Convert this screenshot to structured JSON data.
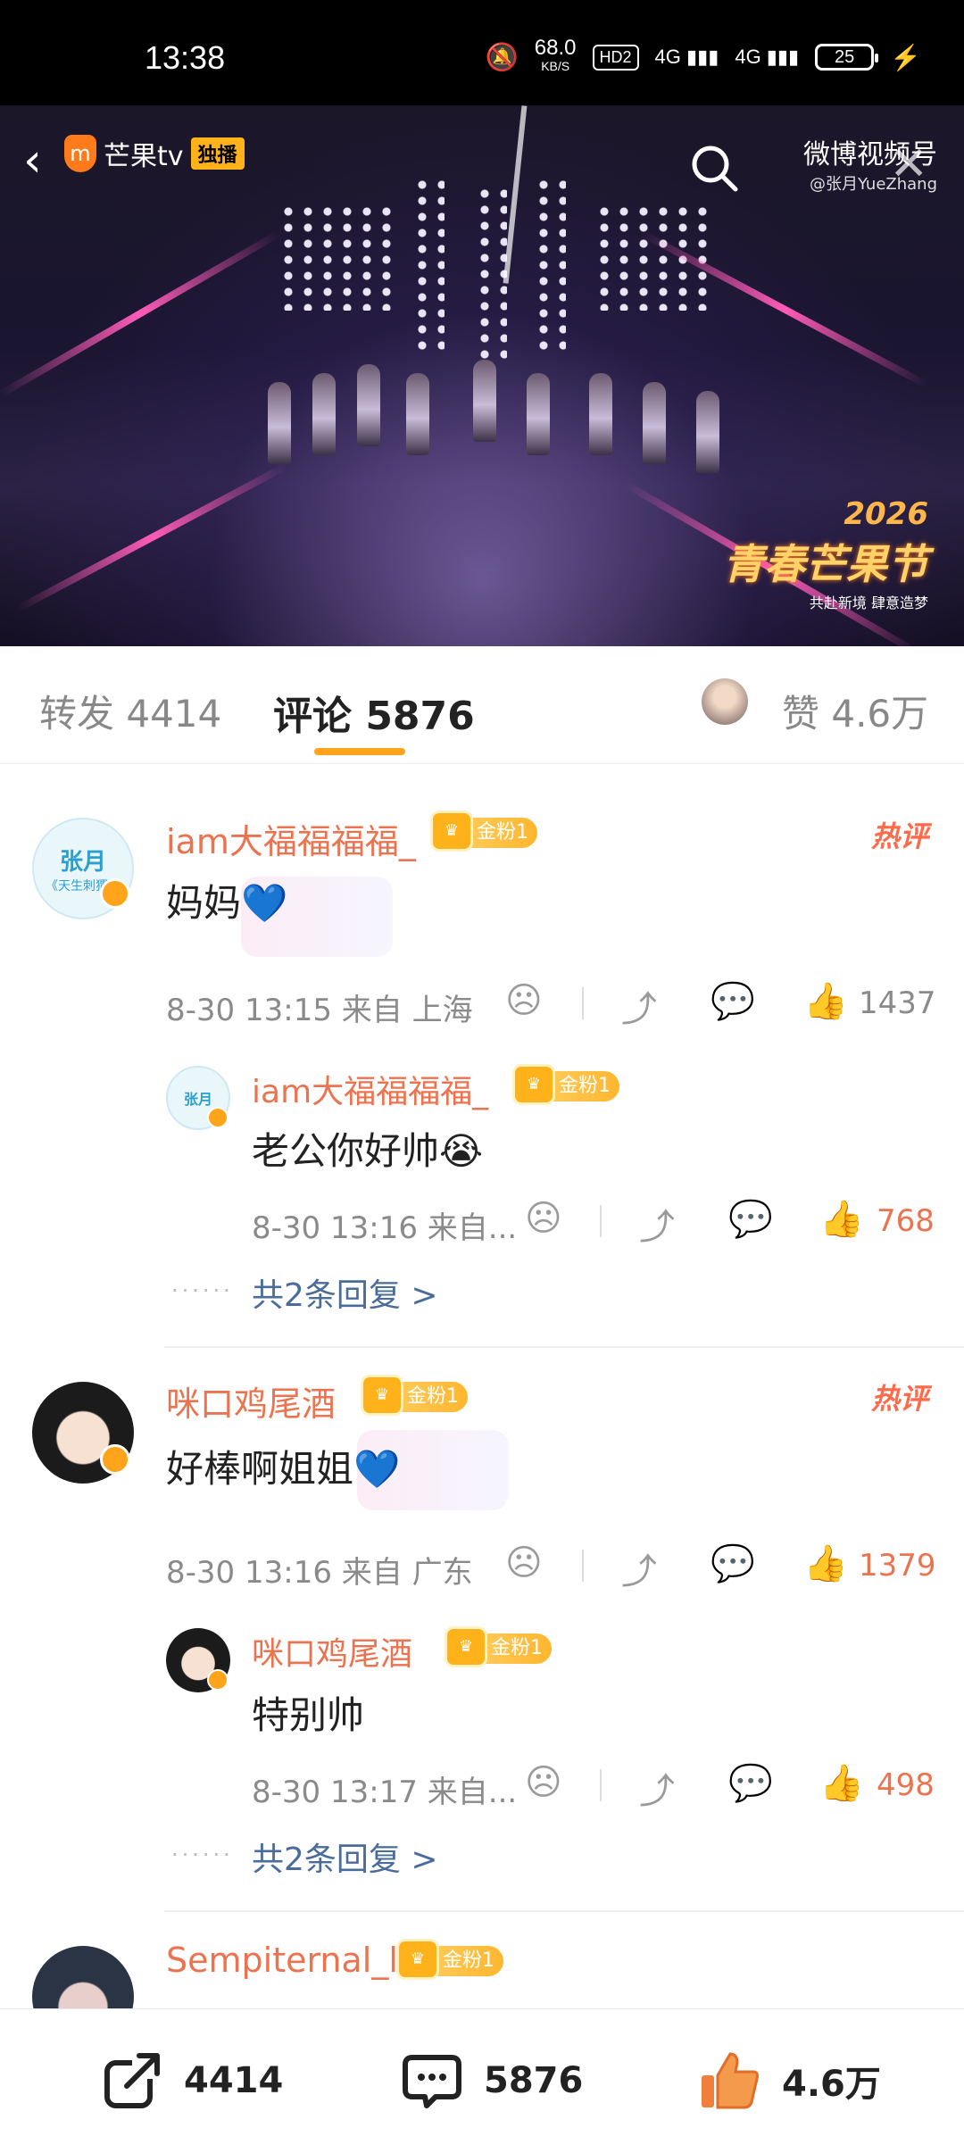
{
  "status_bar": {
    "time": "13:38",
    "net_speed_value": "68.0",
    "net_speed_unit": "KB/S",
    "hd_label": "HD2",
    "sim1": "4G",
    "sim2": "4G",
    "battery": "25"
  },
  "video": {
    "platform_logo": "芒果tv",
    "exclusive_label": "独播",
    "channel_name": "微博视频号",
    "channel_handle": "@张月YueZhang",
    "show_year": "2026",
    "show_name": "青春芒果节",
    "show_tagline": "共赴新境 肆意造梦"
  },
  "tabs": {
    "repost_label": "转发 4414",
    "comment_label": "评论 5876",
    "like_label": "赞 4.6万"
  },
  "comments": [
    {
      "user": "iam大福福福福_",
      "fan_badge": "金粉1",
      "hot_label": "热评",
      "avatar_text_1": "张月",
      "avatar_text_2": "《天生刺猬》",
      "text": "妈妈💙",
      "time_location": "8-30 13:15  来自 上海",
      "likes": "1437",
      "reply": {
        "user": "iam大福福福福_",
        "fan_badge": "金粉1",
        "avatar_text_1": "张月",
        "text": "老公你好帅😭",
        "time_location": "8-30 13:16  来自...",
        "likes": "768"
      },
      "more_replies": "共2条回复 >"
    },
    {
      "user": "咪口鸡尾酒",
      "fan_badge": "金粉1",
      "hot_label": "热评",
      "text": "好棒啊姐姐💙",
      "time_location": "8-30 13:16  来自 广东",
      "likes": "1379",
      "reply": {
        "user": "咪口鸡尾酒",
        "fan_badge": "金粉1",
        "text": "特别帅",
        "time_location": "8-30 13:17  来自...",
        "likes": "498"
      },
      "more_replies": "共2条回复 >"
    },
    {
      "user": "Sempiternal_l",
      "fan_badge": "金粉1"
    }
  ],
  "bottom_bar": {
    "repost_count": "4414",
    "comment_count": "5876",
    "like_count": "4.6万"
  },
  "colors": {
    "accent_orange": "#ffa41b",
    "username_orange": "#eb7350",
    "link_blue": "#4a6c9a"
  }
}
